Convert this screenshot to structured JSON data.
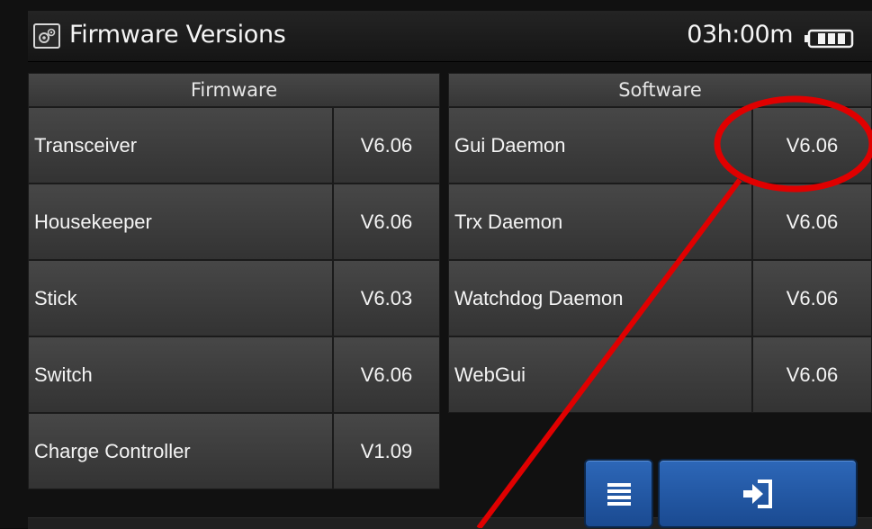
{
  "header": {
    "title": "Firmware Versions",
    "timer": "03h:00m",
    "icon": "gear-icon",
    "battery_icon": "battery-icon"
  },
  "firmware": {
    "heading": "Firmware",
    "rows": [
      {
        "name": "Transceiver",
        "version": "V6.06"
      },
      {
        "name": "Housekeeper",
        "version": "V6.06"
      },
      {
        "name": "Stick",
        "version": "V6.03"
      },
      {
        "name": "Switch",
        "version": "V6.06"
      },
      {
        "name": "Charge Controller",
        "version": "V1.09"
      }
    ]
  },
  "software": {
    "heading": "Software",
    "rows": [
      {
        "name": "Gui Daemon",
        "version": "V6.06"
      },
      {
        "name": "Trx Daemon",
        "version": "V6.06"
      },
      {
        "name": "Watchdog Daemon",
        "version": "V6.06"
      },
      {
        "name": "WebGui",
        "version": "V6.06"
      }
    ]
  },
  "buttons": {
    "menu_icon": "menu-icon",
    "exit_icon": "exit-icon"
  },
  "colors": {
    "button_blue": "#2357a4",
    "annotation_red": "#e00000"
  }
}
